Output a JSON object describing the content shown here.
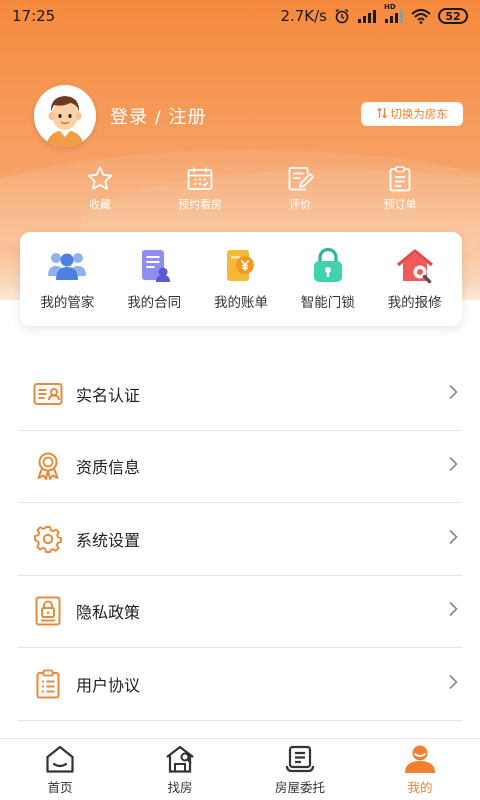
{
  "colors": {
    "accent": "#f07f2f",
    "hero_top": "#f58a3e",
    "hero_bottom": "#fbe3cf",
    "icon_orange": "#e88a3a"
  },
  "status_bar": {
    "time": "17:25",
    "net_speed": "2.7K/s",
    "hd_label": "HD",
    "battery": "52"
  },
  "profile": {
    "login_register": "登录 / 注册",
    "switch_label": "切换为房东"
  },
  "quick_actions": [
    {
      "label": "收藏",
      "icon": "star-icon"
    },
    {
      "label": "预约看房",
      "icon": "calendar-icon"
    },
    {
      "label": "评价",
      "icon": "edit-icon"
    },
    {
      "label": "预订单",
      "icon": "clipboard-icon"
    }
  ],
  "services": [
    {
      "label": "我的管家",
      "icon": "people-icon"
    },
    {
      "label": "我的合同",
      "icon": "contract-icon"
    },
    {
      "label": "我的账单",
      "icon": "bill-icon"
    },
    {
      "label": "智能门锁",
      "icon": "lock-icon"
    },
    {
      "label": "我的报修",
      "icon": "repair-icon"
    }
  ],
  "menu": [
    {
      "label": "实名认证",
      "icon": "id-card-icon"
    },
    {
      "label": "资质信息",
      "icon": "award-icon"
    },
    {
      "label": "系统设置",
      "icon": "settings-icon"
    },
    {
      "label": "隐私政策",
      "icon": "privacy-icon"
    },
    {
      "label": "用户协议",
      "icon": "agreement-icon"
    }
  ],
  "bottom_nav": [
    {
      "label": "首页",
      "icon": "home-icon",
      "active": false
    },
    {
      "label": "找房",
      "icon": "find-house-icon",
      "active": false
    },
    {
      "label": "房屋委托",
      "icon": "entrust-icon",
      "active": false
    },
    {
      "label": "我的",
      "icon": "profile-icon",
      "active": true
    }
  ]
}
